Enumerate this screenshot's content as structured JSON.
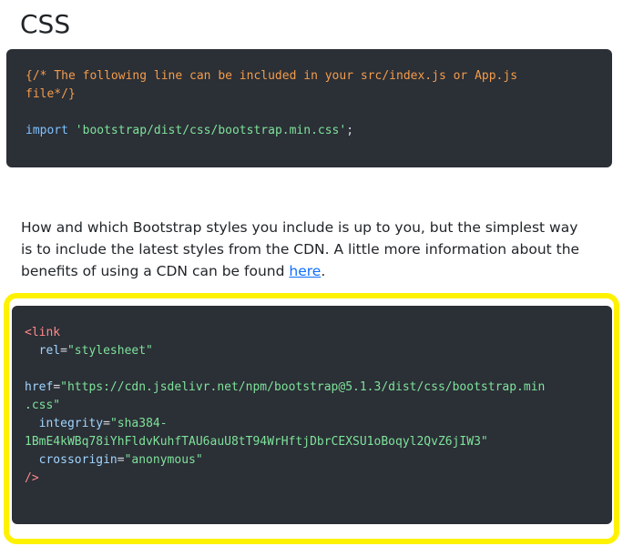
{
  "heading": "CSS",
  "code1": {
    "comment_line1": "{/* The following line can be included in your src/index.js or App.js",
    "comment_line2": "file*/}",
    "import_keyword": "import",
    "import_string": "'bootstrap/dist/css/bootstrap.min.css'",
    "import_end": ";"
  },
  "paragraph": {
    "text": "How and which Bootstrap styles you include is up to you, but the simplest way is to include the latest styles from the CDN. A little more information about the benefits of using a CDN can be found ",
    "link_text": "here",
    "end": "."
  },
  "code2": {
    "tag_open": "<link",
    "rel_attr": "rel",
    "rel_value": "\"stylesheet\"",
    "href_attr": "href",
    "href_value_line1": "\"https://cdn.jsdelivr.net/npm/bootstrap@5.1.3/dist/css/bootstrap.min",
    "href_value_line2": ".css\"",
    "integrity_attr": "integrity",
    "integrity_value_line1": "\"sha384-",
    "integrity_value_line2": "1BmE4kWBq78iYhFldvKuhfTAU6auU8tT94WrHftjDbrCEXSU1oBoqyl2QvZ6jIW3\"",
    "crossorigin_attr": "crossorigin",
    "crossorigin_value": "\"anonymous\"",
    "tag_close": "/>"
  },
  "colors": {
    "code_bg": "#2b2f36",
    "highlight": "#fff200",
    "link": "#0d6efd"
  }
}
